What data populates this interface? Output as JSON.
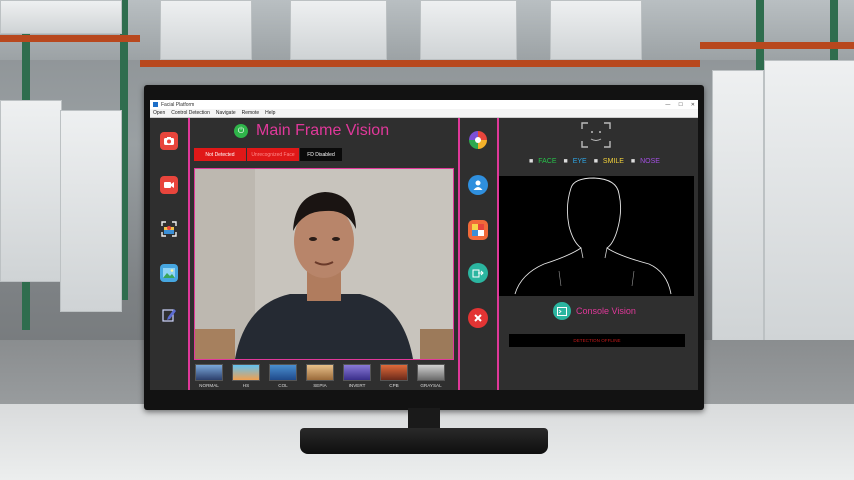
{
  "window": {
    "title": "Facial Platform",
    "controls": [
      "—",
      "☐",
      "✕"
    ]
  },
  "menu": [
    "Open",
    "Control Detection",
    "Navigate",
    "Remote",
    "Help"
  ],
  "main": {
    "title": "Main Frame Vision",
    "status": {
      "not_detected": "Not Detected",
      "unrecognized": "Unrecognized Face",
      "fd_disabled": "FD Disabled"
    },
    "status_colors": {
      "red": "#e01818",
      "black": "#0a0a0a"
    }
  },
  "left_toolbar": [
    {
      "name": "camera-icon",
      "color": "#e8453c"
    },
    {
      "name": "video-icon",
      "color": "#e8453c"
    },
    {
      "name": "face-scan-icon",
      "color": "#3b8fd6"
    },
    {
      "name": "image-icon",
      "color": "#46a6e0"
    },
    {
      "name": "edit-icon",
      "color": "#5b6bd1"
    }
  ],
  "mid_toolbar": [
    {
      "name": "color-wheel-icon"
    },
    {
      "name": "user-icon",
      "color": "#2f8fde"
    },
    {
      "name": "sticker-icon",
      "color": "#f16a3a"
    },
    {
      "name": "export-icon",
      "color": "#2bb5a0"
    },
    {
      "name": "close-icon",
      "color": "#e33434"
    }
  ],
  "filters": [
    "NORMAL",
    "HS",
    "COL",
    "SEPIA",
    "INVERT",
    "CPB",
    "GRAYSAL"
  ],
  "legend": {
    "face": "FACE",
    "eye": "EYE",
    "smile": "SMILE",
    "nose": "NOSE",
    "colors": {
      "face": "#27c24a",
      "eye": "#2ea6e6",
      "smile": "#f3d23b",
      "nose": "#a24fe0"
    }
  },
  "console": {
    "title": "Console Vision",
    "status": "DETECTION OFFLINE"
  },
  "accent": "#e0389a"
}
